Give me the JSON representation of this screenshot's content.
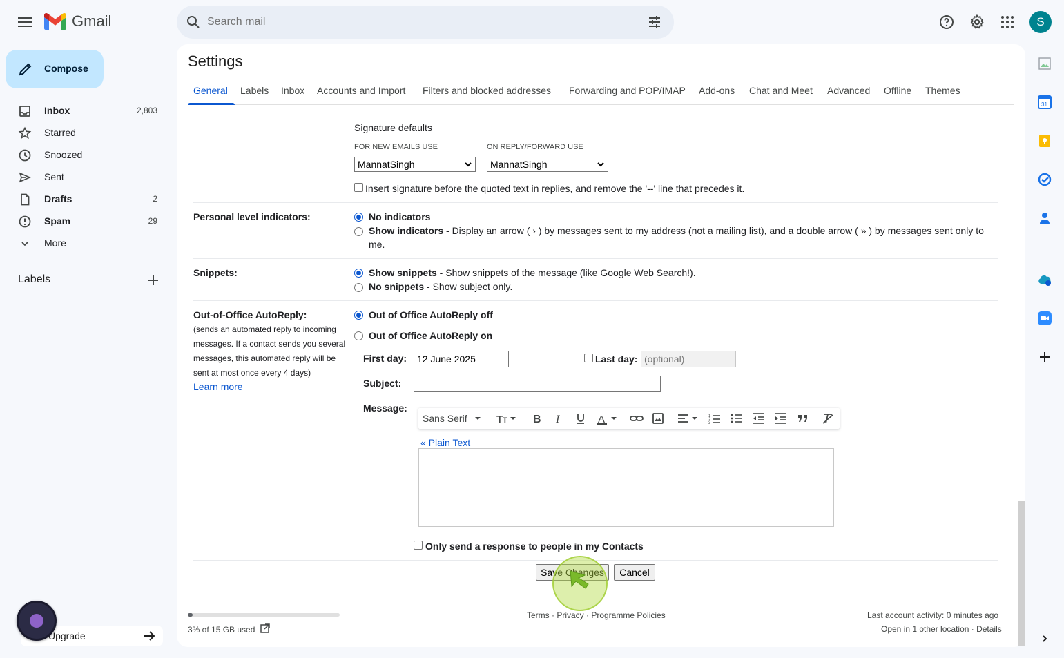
{
  "app": {
    "name": "Gmail"
  },
  "search": {
    "placeholder": "Search mail"
  },
  "account": {
    "initial": "S"
  },
  "compose": {
    "label": "Compose"
  },
  "nav": [
    {
      "label": "Inbox",
      "count": "2,803",
      "icon": "inbox-icon",
      "bold": true
    },
    {
      "label": "Starred",
      "count": "",
      "icon": "star-icon",
      "bold": false
    },
    {
      "label": "Snoozed",
      "count": "",
      "icon": "clock-icon",
      "bold": false
    },
    {
      "label": "Sent",
      "count": "",
      "icon": "send-icon",
      "bold": false
    },
    {
      "label": "Drafts",
      "count": "2",
      "icon": "draft-icon",
      "bold": true
    },
    {
      "label": "Spam",
      "count": "29",
      "icon": "spam-icon",
      "bold": true
    },
    {
      "label": "More",
      "count": "",
      "icon": "chevron-down-icon",
      "bold": false
    }
  ],
  "labels_heading": "Labels",
  "upgrade": {
    "label": "Upgrade"
  },
  "settings": {
    "title": "Settings",
    "tabs": [
      "General",
      "Labels",
      "Inbox",
      "Accounts and Import",
      "Filters and blocked addresses",
      "Forwarding and POP/IMAP",
      "Add-ons",
      "Chat and Meet",
      "Advanced",
      "Offline",
      "Themes"
    ],
    "active_tab": "General",
    "signature": {
      "heading": "Signature defaults",
      "new_label": "FOR NEW EMAILS USE",
      "new_value": "MannatSingh",
      "reply_label": "ON REPLY/FORWARD USE",
      "reply_value": "MannatSingh",
      "insert_before": "Insert signature before the quoted text in replies, and remove the '--' line that precedes it."
    },
    "personal": {
      "label": "Personal level indicators:",
      "opt1": "No indicators",
      "opt2": "Show indicators",
      "opt2_desc": " - Display an arrow ( › ) by messages sent to my address (not a mailing list), and a double arrow ( » ) by messages sent only to",
      "opt2_desc2": "me."
    },
    "snippets": {
      "label": "Snippets:",
      "opt1": "Show snippets",
      "opt1_desc": " - Show snippets of the message (like Google Web Search!).",
      "opt2": "No snippets",
      "opt2_desc": " - Show subject only."
    },
    "ooo": {
      "label": "Out-of-Office AutoReply:",
      "note_lines": [
        "(sends an automated reply to incoming",
        "messages. If a contact sends you several",
        "messages, this automated reply will be",
        "sent at most once every 4 days)"
      ],
      "learn_more": "Learn more",
      "off": "Out of Office AutoReply off",
      "on": "Out of Office AutoReply on",
      "first_day_label": "First day:",
      "first_day_value": "12 June 2025",
      "last_day_label": "Last day:",
      "last_day_placeholder": "(optional)",
      "subject_label": "Subject:",
      "message_label": "Message:",
      "font": "Sans Serif",
      "plain_text": "« Plain Text",
      "contacts_only": "Only send a response to people in my Contacts"
    },
    "save": "Save Changes",
    "cancel": "Cancel"
  },
  "footer": {
    "storage": "3% of 15 GB used",
    "storage_fraction": 0.03,
    "links": "Terms · Privacy · Programme Policies",
    "activity": "Last account activity: 0 minutes ago",
    "details": "Open in 1 other location · Details"
  },
  "colors": {
    "accent": "#0b57d0",
    "compose_bg": "#c2e7ff",
    "page_bg": "#f6f8fc"
  }
}
